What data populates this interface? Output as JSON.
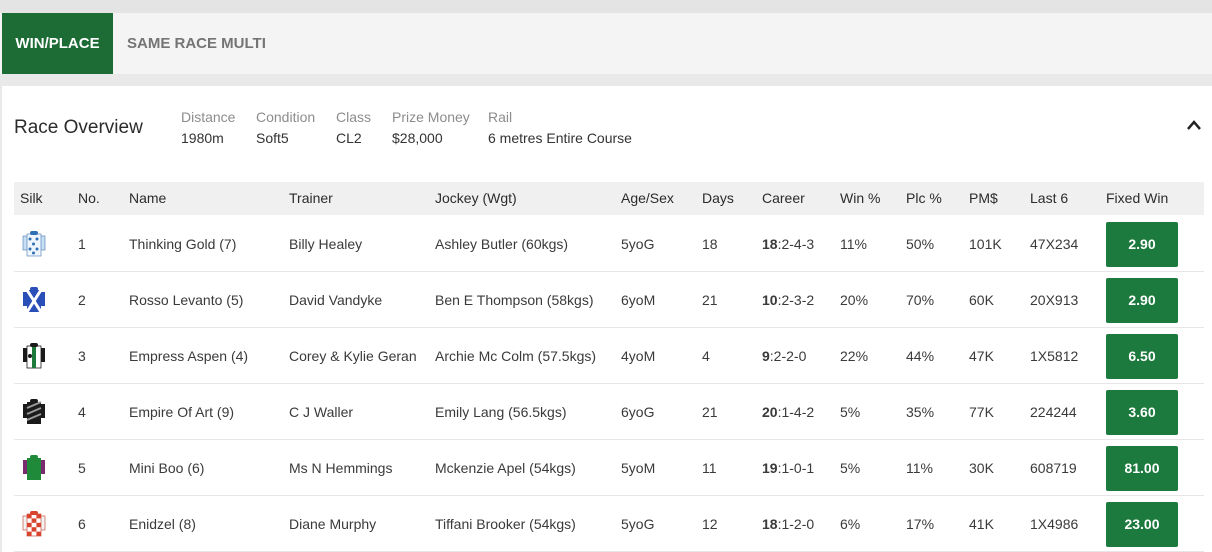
{
  "tabs": [
    {
      "label": "WIN/PLACE",
      "active": true
    },
    {
      "label": "SAME RACE MULTI",
      "active": false
    }
  ],
  "overview": {
    "title": "Race Overview",
    "items": [
      {
        "label": "Distance",
        "value": "1980m"
      },
      {
        "label": "Condition",
        "value": "Soft5"
      },
      {
        "label": "Class",
        "value": "CL2"
      },
      {
        "label": "Prize Money",
        "value": "$28,000"
      },
      {
        "label": "Rail",
        "value": "6 metres Entire Course"
      }
    ],
    "collapse_icon": "chevron-up-icon"
  },
  "table": {
    "headers": [
      "Silk",
      "No.",
      "Name",
      "Trainer",
      "Jockey (Wgt)",
      "Age/Sex",
      "Days",
      "Career",
      "Win %",
      "Plc %",
      "PM$",
      "Last 6",
      "Fixed Win"
    ],
    "rows": [
      {
        "no": "1",
        "name": "Thinking Gold (7)",
        "trainer": "Billy Healey",
        "jockey": "Ashley Butler (60kgs)",
        "agesex": "5yoG",
        "days": "18",
        "career_starts": "18",
        "career_rest": ":2-4-3",
        "win": "11%",
        "plc": "50%",
        "pm": "101K",
        "last6": "47X234",
        "fixed": "2.90"
      },
      {
        "no": "2",
        "name": "Rosso Levanto (5)",
        "trainer": "David Vandyke",
        "jockey": "Ben E Thompson (58kgs)",
        "agesex": "6yoM",
        "days": "21",
        "career_starts": "10",
        "career_rest": ":2-3-2",
        "win": "20%",
        "plc": "70%",
        "pm": "60K",
        "last6": "20X913",
        "fixed": "2.90"
      },
      {
        "no": "3",
        "name": "Empress Aspen (4)",
        "trainer": "Corey & Kylie Geran",
        "jockey": "Archie Mc Colm (57.5kgs)",
        "agesex": "4yoM",
        "days": "4",
        "career_starts": "9",
        "career_rest": ":2-2-0",
        "win": "22%",
        "plc": "44%",
        "pm": "47K",
        "last6": "1X5812",
        "fixed": "6.50"
      },
      {
        "no": "4",
        "name": "Empire Of Art (9)",
        "trainer": "C J Waller",
        "jockey": "Emily Lang (56.5kgs)",
        "agesex": "6yoG",
        "days": "21",
        "career_starts": "20",
        "career_rest": ":1-4-2",
        "win": "5%",
        "plc": "35%",
        "pm": "77K",
        "last6": "224244",
        "fixed": "3.60"
      },
      {
        "no": "5",
        "name": "Mini Boo (6)",
        "trainer": "Ms N Hemmings",
        "jockey": "Mckenzie Apel (54kgs)",
        "agesex": "5yoM",
        "days": "11",
        "career_starts": "19",
        "career_rest": ":1-0-1",
        "win": "5%",
        "plc": "11%",
        "pm": "30K",
        "last6": "608719",
        "fixed": "81.00"
      },
      {
        "no": "6",
        "name": "Enidzel (8)",
        "trainer": "Diane Murphy",
        "jockey": "Tiffani Brooker (54kgs)",
        "agesex": "5yoG",
        "days": "12",
        "career_starts": "18",
        "career_rest": ":1-2-0",
        "win": "6%",
        "plc": "17%",
        "pm": "41K",
        "last6": "1X4986",
        "fixed": "23.00"
      }
    ]
  },
  "colors": {
    "brand_green": "#1d6b35",
    "odds_green": "#1d7a3e"
  }
}
